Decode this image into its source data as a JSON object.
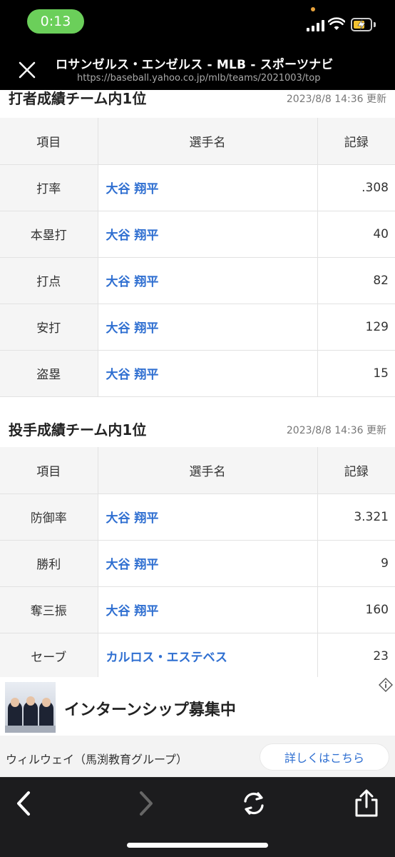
{
  "status_bar": {
    "time": "0:13"
  },
  "browser": {
    "title": "ロサンゼルス・エンゼルス - MLB - スポーツナビ",
    "url": "https://baseball.yahoo.co.jp/mlb/teams/2021003/top"
  },
  "batting": {
    "title": "打者成績チーム内1位",
    "updated": "2023/8/8 14:36 更新",
    "headers": {
      "item": "項目",
      "player": "選手名",
      "record": "記録"
    },
    "rows": [
      {
        "item": "打率",
        "player": "大谷 翔平",
        "record": ".308"
      },
      {
        "item": "本塁打",
        "player": "大谷 翔平",
        "record": "40"
      },
      {
        "item": "打点",
        "player": "大谷 翔平",
        "record": "82"
      },
      {
        "item": "安打",
        "player": "大谷 翔平",
        "record": "129"
      },
      {
        "item": "盗塁",
        "player": "大谷 翔平",
        "record": "15"
      }
    ]
  },
  "pitching": {
    "title": "投手成績チーム内1位",
    "updated": "2023/8/8 14:36 更新",
    "headers": {
      "item": "項目",
      "player": "選手名",
      "record": "記録"
    },
    "rows": [
      {
        "item": "防御率",
        "player": "大谷 翔平",
        "record": "3.321"
      },
      {
        "item": "勝利",
        "player": "大谷 翔平",
        "record": "9"
      },
      {
        "item": "奪三振",
        "player": "大谷 翔平",
        "record": "160"
      },
      {
        "item": "セーブ",
        "player": "カルロス・エステベス",
        "record": "23"
      }
    ]
  },
  "ad": {
    "headline": "インターンシップ募集中",
    "advertiser": "ウィルウェイ（馬渕教育グループ）",
    "cta": "詳しくはこちら"
  },
  "icons": {
    "close": "close-icon",
    "back": "chevron-left-icon",
    "forward": "chevron-right-icon",
    "reload": "reload-icon",
    "share": "share-icon",
    "ad_info": "info-icon"
  },
  "colors": {
    "link": "#2f6fd1",
    "time_pill": "#6bcf5a",
    "battery": "#f2c230"
  }
}
